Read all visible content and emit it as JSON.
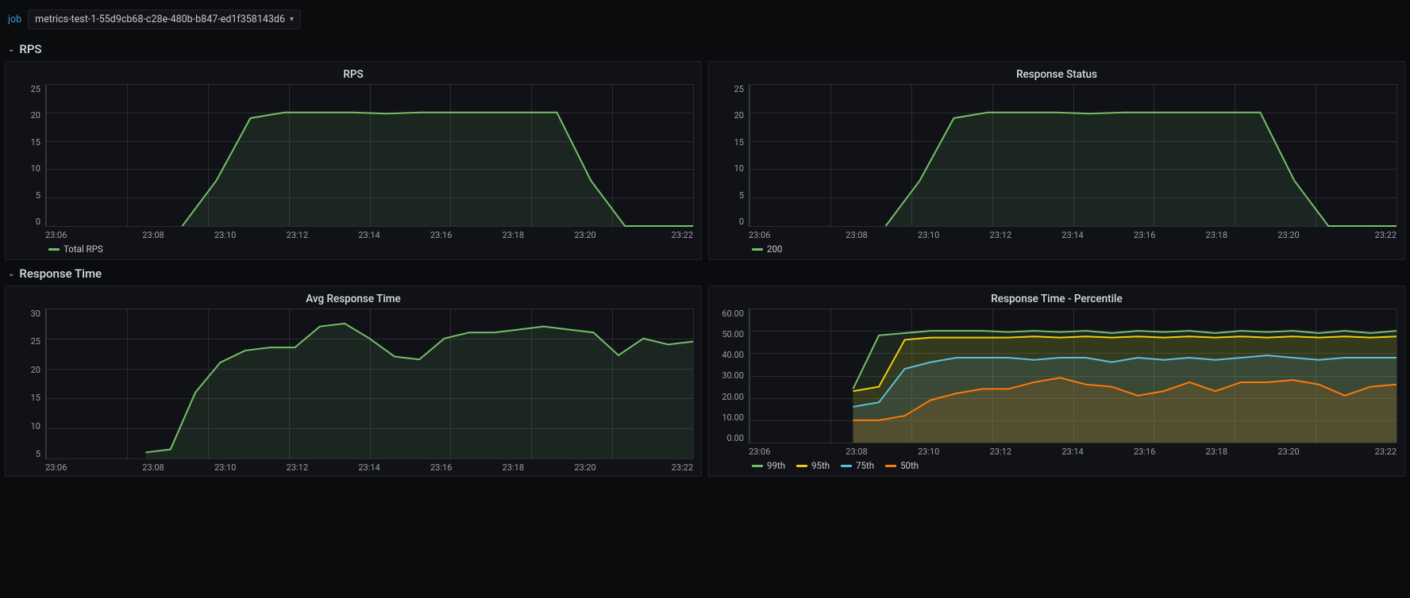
{
  "topbar": {
    "job_label": "job",
    "job_value": "metrics-test-1-55d9cb68-c28e-480b-b847-ed1f358143d6"
  },
  "sections": {
    "rps": {
      "title": "RPS"
    },
    "response_time": {
      "title": "Response Time"
    }
  },
  "panels": {
    "rps": {
      "title": "RPS",
      "legend": [
        "Total RPS"
      ]
    },
    "status": {
      "title": "Response Status",
      "legend": [
        "200"
      ]
    },
    "avg_rt": {
      "title": "Avg Response Time"
    },
    "pct_rt": {
      "title": "Response Time - Percentile",
      "legend": [
        "99th",
        "95th",
        "75th",
        "50th"
      ]
    }
  },
  "colors": {
    "green": "#73bf69",
    "yellow": "#f2cc0c",
    "teal": "#5bc0de",
    "orange": "#ff780a"
  },
  "chart_data": [
    {
      "id": "rps",
      "type": "area",
      "title": "RPS",
      "ylabel": "",
      "ylim": [
        0,
        25
      ],
      "y_ticks": [
        0,
        5,
        10,
        15,
        20,
        25
      ],
      "x_ticks": [
        "23:06",
        "23:08",
        "23:10",
        "23:12",
        "23:14",
        "23:16",
        "23:18",
        "23:20",
        "23:22"
      ],
      "x": [
        "23:06",
        "23:07",
        "23:08",
        "23:09",
        "23:09.5",
        "23:10",
        "23:11",
        "23:12",
        "23:13",
        "23:14",
        "23:15",
        "23:16",
        "23:17",
        "23:18",
        "23:19",
        "23:19.5",
        "23:20",
        "23:21",
        "23:22",
        "23:23"
      ],
      "series": [
        {
          "name": "Total RPS",
          "color": "green",
          "values": [
            null,
            null,
            null,
            null,
            0,
            8,
            19,
            20,
            20,
            20,
            19.8,
            20,
            20,
            20,
            20,
            20,
            8,
            0,
            0,
            0
          ]
        }
      ]
    },
    {
      "id": "status",
      "type": "area",
      "title": "Response Status",
      "ylabel": "",
      "ylim": [
        0,
        25
      ],
      "y_ticks": [
        0,
        5,
        10,
        15,
        20,
        25
      ],
      "x_ticks": [
        "23:06",
        "23:08",
        "23:10",
        "23:12",
        "23:14",
        "23:16",
        "23:18",
        "23:20",
        "23:22"
      ],
      "x": [
        "23:06",
        "23:07",
        "23:08",
        "23:09",
        "23:09.5",
        "23:10",
        "23:11",
        "23:12",
        "23:13",
        "23:14",
        "23:15",
        "23:16",
        "23:17",
        "23:18",
        "23:19",
        "23:19.5",
        "23:20",
        "23:21",
        "23:22",
        "23:23"
      ],
      "series": [
        {
          "name": "200",
          "color": "green",
          "values": [
            null,
            null,
            null,
            null,
            0,
            8,
            19,
            20,
            20,
            20,
            19.8,
            20,
            20,
            20,
            20,
            20,
            8,
            0,
            0,
            0
          ]
        }
      ]
    },
    {
      "id": "avg_rt",
      "type": "area",
      "title": "Avg Response Time",
      "ylabel": "",
      "ylim": [
        5,
        30
      ],
      "y_ticks": [
        5,
        10,
        15,
        20,
        25,
        30
      ],
      "x_ticks": [
        "23:06",
        "23:08",
        "23:10",
        "23:12",
        "23:14",
        "23:16",
        "23:18",
        "23:20",
        "23:22"
      ],
      "x": [
        "23:06",
        "23:07",
        "23:08",
        "23:09",
        "23:09.5",
        "23:10",
        "23:10.5",
        "23:11",
        "23:11.5",
        "23:12",
        "23:12.5",
        "23:13",
        "23:13.5",
        "23:14",
        "23:14.5",
        "23:15",
        "23:15.5",
        "23:16",
        "23:16.5",
        "23:17",
        "23:17.5",
        "23:18",
        "23:18.5",
        "23:19",
        "23:19.5",
        "23:20",
        "23:20.5"
      ],
      "series": [
        {
          "name": "Avg Response Time",
          "color": "green",
          "values": [
            null,
            null,
            null,
            null,
            6,
            6.5,
            16,
            21,
            23,
            23.5,
            23.5,
            27,
            27.5,
            25,
            22,
            21.5,
            25,
            26,
            26,
            26.5,
            27,
            26.5,
            26,
            22.2,
            25,
            24,
            24.5
          ]
        }
      ]
    },
    {
      "id": "pct_rt",
      "type": "area",
      "title": "Response Time - Percentile",
      "ylabel": "",
      "ylim": [
        0,
        60
      ],
      "y_ticks": [
        0,
        10,
        20,
        30,
        40,
        50,
        60
      ],
      "x_ticks": [
        "23:06",
        "23:08",
        "23:10",
        "23:12",
        "23:14",
        "23:16",
        "23:18",
        "23:20",
        "23:22"
      ],
      "x": [
        "23:06",
        "23:07",
        "23:08",
        "23:09",
        "23:09.3",
        "23:09.5",
        "23:10",
        "23:10.5",
        "23:11",
        "23:11.5",
        "23:12",
        "23:12.5",
        "23:13",
        "23:13.5",
        "23:14",
        "23:14.5",
        "23:15",
        "23:15.5",
        "23:16",
        "23:16.5",
        "23:17",
        "23:17.5",
        "23:18",
        "23:18.5",
        "23:19",
        "23:19.3"
      ],
      "series": [
        {
          "name": "99th",
          "color": "green",
          "values": [
            null,
            null,
            null,
            null,
            24,
            48,
            49,
            50,
            50,
            50,
            49.5,
            50,
            49.5,
            50,
            49,
            50,
            49.5,
            50,
            49,
            50,
            49.5,
            50,
            49,
            50,
            49,
            50
          ]
        },
        {
          "name": "95th",
          "color": "yellow",
          "values": [
            null,
            null,
            null,
            null,
            23,
            25,
            46,
            47,
            47,
            47,
            47,
            47.5,
            47,
            47.5,
            47,
            47.5,
            47,
            47.5,
            47,
            47.5,
            47,
            47.5,
            47,
            47.5,
            47,
            47.5
          ]
        },
        {
          "name": "75th",
          "color": "teal",
          "values": [
            null,
            null,
            null,
            null,
            16,
            18,
            33,
            36,
            38,
            38,
            38,
            37,
            38,
            38,
            36,
            38,
            37,
            38,
            37,
            38,
            39,
            38,
            37,
            38,
            38,
            38
          ]
        },
        {
          "name": "50th",
          "color": "orange",
          "values": [
            null,
            null,
            null,
            null,
            10,
            10,
            12,
            19,
            22,
            24,
            24,
            27,
            29,
            26,
            25,
            21,
            23,
            27,
            23,
            27,
            27,
            28,
            26,
            21,
            25,
            26
          ]
        }
      ]
    }
  ]
}
